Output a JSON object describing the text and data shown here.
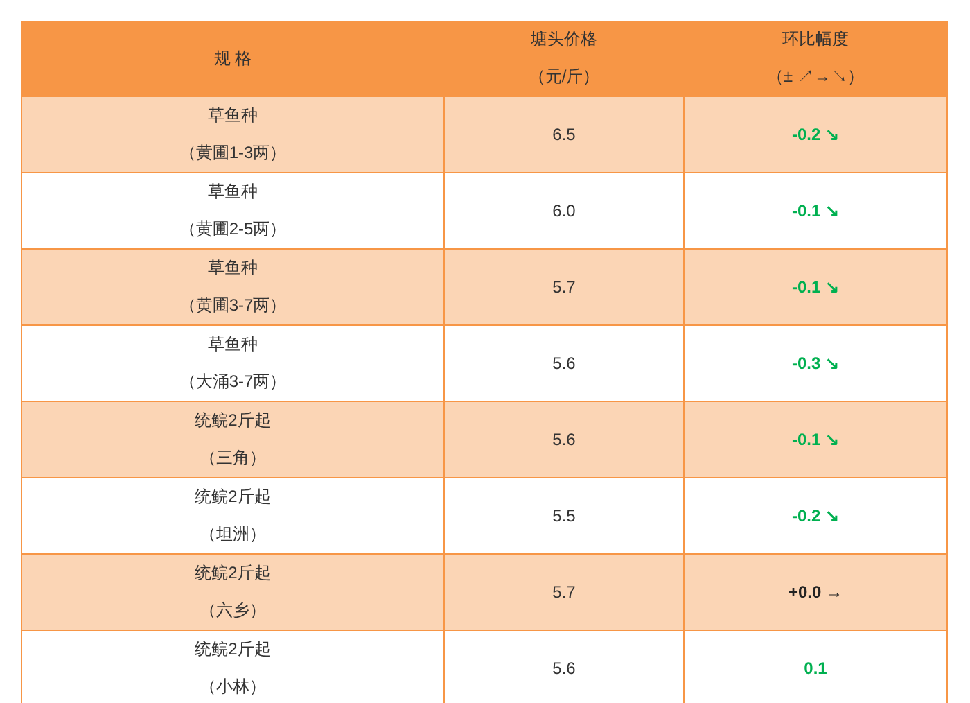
{
  "table": {
    "columns": [
      {
        "lines": [
          "规 格"
        ]
      },
      {
        "lines": [
          "塘头价格",
          "（元/斤）"
        ]
      },
      {
        "lines": [
          "环比幅度",
          "（± ↗→↘）"
        ]
      }
    ],
    "rows": [
      {
        "spec": "草鱼种",
        "origin": "（黄圃1-3两）",
        "price": "6.5",
        "change": "-0.2 ↘",
        "color": "#00b050"
      },
      {
        "spec": "草鱼种",
        "origin": "（黄圃2-5两）",
        "price": "6.0",
        "change": "-0.1 ↘",
        "color": "#00b050"
      },
      {
        "spec": "草鱼种",
        "origin": "（黄圃3-7两）",
        "price": "5.7",
        "change": "-0.1 ↘",
        "color": "#00b050"
      },
      {
        "spec": "草鱼种",
        "origin": "（大涌3-7两）",
        "price": "5.6",
        "change": "-0.3 ↘",
        "color": "#00b050"
      },
      {
        "spec": "统鲩2斤起",
        "origin": "（三角）",
        "price": "5.6",
        "change": "-0.1 ↘",
        "color": "#00b050"
      },
      {
        "spec": "统鲩2斤起",
        "origin": "（坦洲）",
        "price": "5.5",
        "change": "-0.2 ↘",
        "color": "#00b050"
      },
      {
        "spec": "统鲩2斤起",
        "origin": "（六乡）",
        "price": "5.7",
        "change": "+0.0 →",
        "color": "#222222"
      },
      {
        "spec": "统鲩2斤起",
        "origin": "（小林）",
        "price": "5.6",
        "change": "0.1",
        "color": "#00b050"
      }
    ]
  }
}
